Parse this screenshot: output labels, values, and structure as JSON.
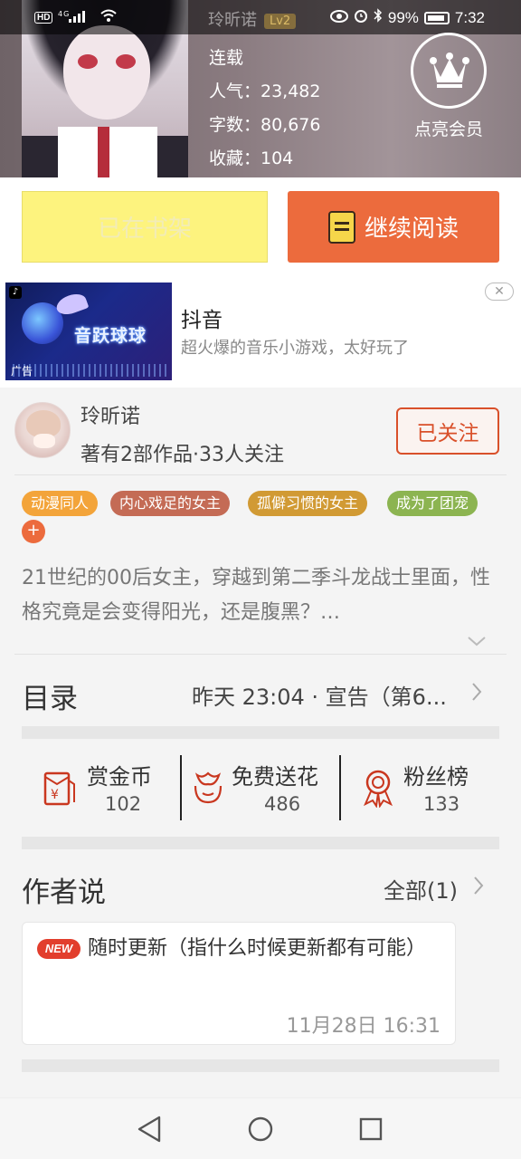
{
  "status_bar": {
    "left_icons": [
      "HD",
      "4G",
      "signal-icon",
      "wifi-icon"
    ],
    "overlay_author": "玲昕诺",
    "overlay_level": "Lv2",
    "battery": "99%",
    "time": "7:32"
  },
  "book": {
    "status": "连载",
    "popularity": "人气：23,482",
    "word_count": "字数：80,676",
    "favorites": "收藏：104",
    "vip_label": "点亮会员"
  },
  "actions": {
    "shelf_label": "已在书架",
    "read_label": "继续阅读"
  },
  "ad": {
    "app_name": "抖音",
    "description": "超火爆的音乐小游戏，太好玩了",
    "image_title": "音跃球球",
    "ad_tag": "广告",
    "close": "✕"
  },
  "author": {
    "name": "玲昕诺",
    "info": "著有2部作品·33人关注",
    "follow_label": "已关注"
  },
  "tags": [
    {
      "label": "动漫同人",
      "color": "#f3a43a"
    },
    {
      "label": "内心戏足的女主",
      "color": "#c46b55"
    },
    {
      "label": "孤僻习惯的女主",
      "color": "#d19a34"
    },
    {
      "label": "成为了团宠",
      "color": "#8cb451"
    }
  ],
  "tag_add": "+",
  "description": "21世纪的00后女主，穿越到第二季斗龙战士里面，性格究竟是会变得阳光，还是腹黑？…",
  "catalog": {
    "title": "目录",
    "latest": "昨天 23:04 · 宣告（第6..."
  },
  "stats": [
    {
      "label": "赏金币",
      "value": "102",
      "icon": "coin-envelope-icon"
    },
    {
      "label": "免费送花",
      "value": "486",
      "icon": "flower-icon"
    },
    {
      "label": "粉丝榜",
      "value": "133",
      "icon": "ribbon-medal-icon"
    }
  ],
  "author_says": {
    "title": "作者说",
    "all_label": "全部(1)",
    "badge": "NEW",
    "text": "随时更新（指什么时候更新都有可能）",
    "time": "11月28日  16:31"
  },
  "colors": {
    "accent": "#ec6b3d",
    "follow": "#d9502a",
    "shelf_bg": "#fdf37e"
  }
}
